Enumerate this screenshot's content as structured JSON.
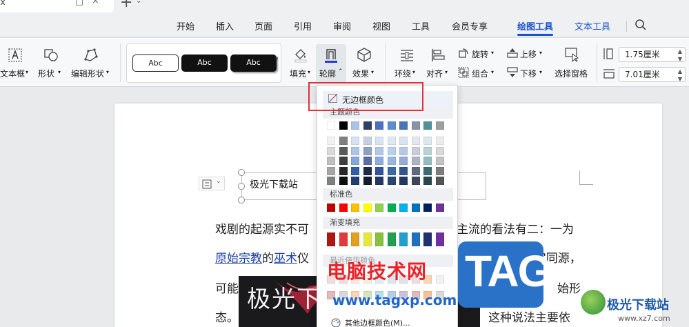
{
  "titlebar": {
    "tab_text": "cx",
    "close_glyph": "×",
    "add_glyph": "+",
    "more_glyph": "⌄"
  },
  "menu": {
    "tabs": [
      "开始",
      "插入",
      "页面",
      "引用",
      "审阅",
      "视图",
      "工具",
      "会员专享",
      "绘图工具",
      "文本工具"
    ],
    "active": "绘图工具"
  },
  "ribbon": {
    "textbox_label": "文本框",
    "shape_label": "形状",
    "edit_shape_label": "编辑形状",
    "style_sample": "Abc",
    "fill_label": "填充",
    "outline_label": "轮廓",
    "effect_label": "效果",
    "wrap_label": "环绕",
    "align_label": "对齐",
    "rotate_label": "旋转",
    "group_label": "组合",
    "bring_forward_label": "上移",
    "send_backward_label": "下移",
    "select_pane_label": "选择窗格",
    "height_value": "1.75厘米",
    "width_value": "7.01厘米",
    "outline_color": "#1b3fd0"
  },
  "document": {
    "textbox_text": "极光下载站",
    "line1_a": "戏剧的起源实不可",
    "line1_b": "主流的看法有二：一为",
    "line2_link1": "原始宗教",
    "line2_mid": "的",
    "line2_link2": "巫术",
    "line2_rest": "仪",
    "line2_quote1": "“",
    "line2_word1": "舞",
    "line2_mid2": "”、“",
    "line2_word2": "武",
    "line2_end": "”三字同源，",
    "line3_a": "可能",
    "line3_b": "始形",
    "line4_a": "态。",
    "line4_b": "这种说法主要依",
    "photo_text": "极光下"
  },
  "dropdown": {
    "no_border": "无边框颜色",
    "theme_colors": "主题颜色",
    "standard_colors": "标准色",
    "gradient_fill": "渐变填充",
    "recent_colors": "最近使用颜色",
    "more_colors": "其他边框颜色(M)...",
    "theme_top": [
      "#ffffff",
      "#000000",
      "#aac4e8",
      "#2f3f6a",
      "#4e70c0",
      "#5a8fd0",
      "#4a74b8",
      "#8693a8",
      "#52909a",
      "#9e9e9e"
    ],
    "theme_shades": [
      [
        "#f2f2f2",
        "#7f7f7f",
        "#d6e2f4",
        "#c7cfe0",
        "#d9e4f3",
        "#dde8f5",
        "#dbe3f1",
        "#e4e6ec",
        "#dbe9eb",
        "#ececec"
      ],
      [
        "#d9d9d9",
        "#595959",
        "#adc5e9",
        "#8fa0c2",
        "#b4c7e8",
        "#bbd0ea",
        "#b8c8e4",
        "#c9cdd9",
        "#b8d3d6",
        "#d8d8d8"
      ],
      [
        "#bfbfbf",
        "#3f3f3f",
        "#84a7dd",
        "#5a6fa2",
        "#8dabdc",
        "#98b8df",
        "#94acd6",
        "#aeb4c6",
        "#94bdc2",
        "#c4c4c4"
      ],
      [
        "#a6a6a6",
        "#262626",
        "#2f5fa8",
        "#1f2a48",
        "#34539a",
        "#3a6aa7",
        "#33558e",
        "#5f6a80",
        "#3b6b73",
        "#7d7d7d"
      ],
      [
        "#808080",
        "#0d0d0d",
        "#1f3f70",
        "#141c30",
        "#233866",
        "#27476f",
        "#22395f",
        "#3f4756",
        "#27474d",
        "#545454"
      ]
    ],
    "standard": [
      "#c00000",
      "#ff0000",
      "#ffc000",
      "#ffff00",
      "#92d050",
      "#00b050",
      "#00b0f0",
      "#0070c0",
      "#002060",
      "#7030a0"
    ],
    "gradient": [
      "#b01515",
      "#e03a3a",
      "#e0a020",
      "#e6e640",
      "#88c040",
      "#20a050",
      "#20a0d0",
      "#2070c0",
      "#203070",
      "#7030a0"
    ],
    "recent_row1": [
      "#f2dcdb",
      "#f2dcdb",
      "#fde9d9",
      "#ebf1de",
      "#dbeef3",
      "#dce6f1",
      "#e4dfec",
      "#f2dcdb",
      "#fbd4b4",
      "#f2f2f2"
    ],
    "recent_row2": [
      "#e6b8b7",
      "#d8d8d8",
      "#fcd5b4",
      "#d7e4bc",
      "#b7dee8",
      "#b8cce4",
      "#ccc0da",
      "#e6b8b7",
      "#fac090",
      "#d9d9d9"
    ]
  },
  "watermark": {
    "cn": "电脑技术网",
    "url": "www.tagxp.com",
    "tag": "TAG",
    "site": "极光下载站",
    "site_url": "www.xz7.com"
  }
}
